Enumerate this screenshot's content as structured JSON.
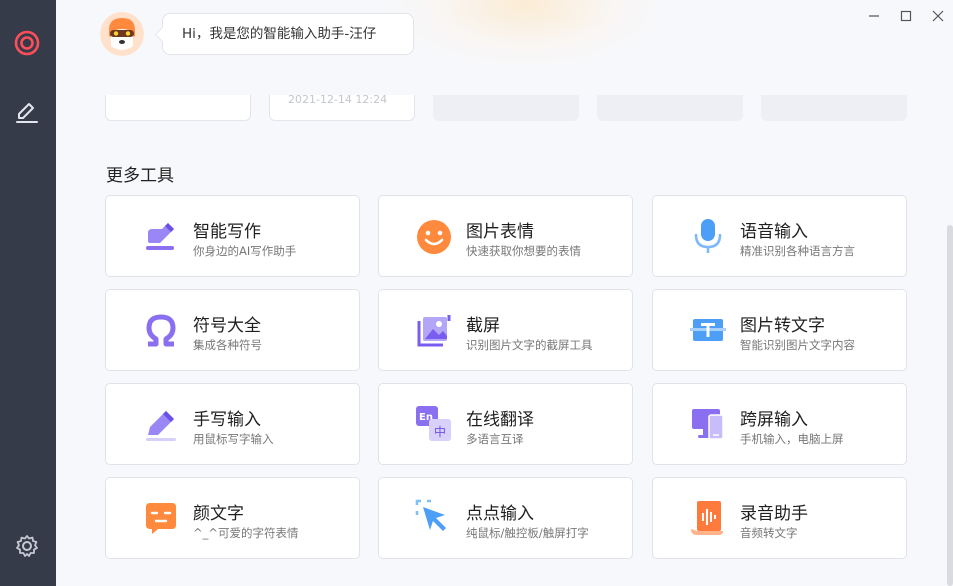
{
  "assistant": {
    "greeting": "Hi，我是您的智能输入助手-汪仔"
  },
  "top_cards": {
    "date_fragment": "2021-12-14 12:24"
  },
  "section": {
    "title": "更多工具"
  },
  "tools": [
    {
      "name": "智能写作",
      "desc": "你身边的AI写作助手",
      "icon": "ai-writing-icon"
    },
    {
      "name": "图片表情",
      "desc": "快速获取你想要的表情",
      "icon": "emoji-icon"
    },
    {
      "name": "语音输入",
      "desc": "精准识别各种语言方言",
      "icon": "microphone-icon"
    },
    {
      "name": "符号大全",
      "desc": "集成各种符号",
      "icon": "omega-icon"
    },
    {
      "name": "截屏",
      "desc": "识别图片文字的截屏工具",
      "icon": "screenshot-icon"
    },
    {
      "name": "图片转文字",
      "desc": "智能识别图片文字内容",
      "icon": "ocr-icon"
    },
    {
      "name": "手写输入",
      "desc": "用鼠标写字输入",
      "icon": "pen-icon"
    },
    {
      "name": "在线翻译",
      "desc": "多语言互译",
      "icon": "translate-icon"
    },
    {
      "name": "跨屏输入",
      "desc": "手机输入，电脑上屏",
      "icon": "cross-screen-icon"
    },
    {
      "name": "颜文字",
      "desc": "^_^可爱的字符表情",
      "icon": "kaomoji-icon"
    },
    {
      "name": "点点输入",
      "desc": "纯鼠标/触控板/触屏打字",
      "icon": "click-input-icon"
    },
    {
      "name": "录音助手",
      "desc": "音频转文字",
      "icon": "recorder-icon"
    }
  ],
  "colors": {
    "sidebar": "#353b49",
    "accent_orange": "#ff8a3d",
    "accent_purple": "#8a6ff0",
    "accent_blue": "#4d9ef6"
  }
}
